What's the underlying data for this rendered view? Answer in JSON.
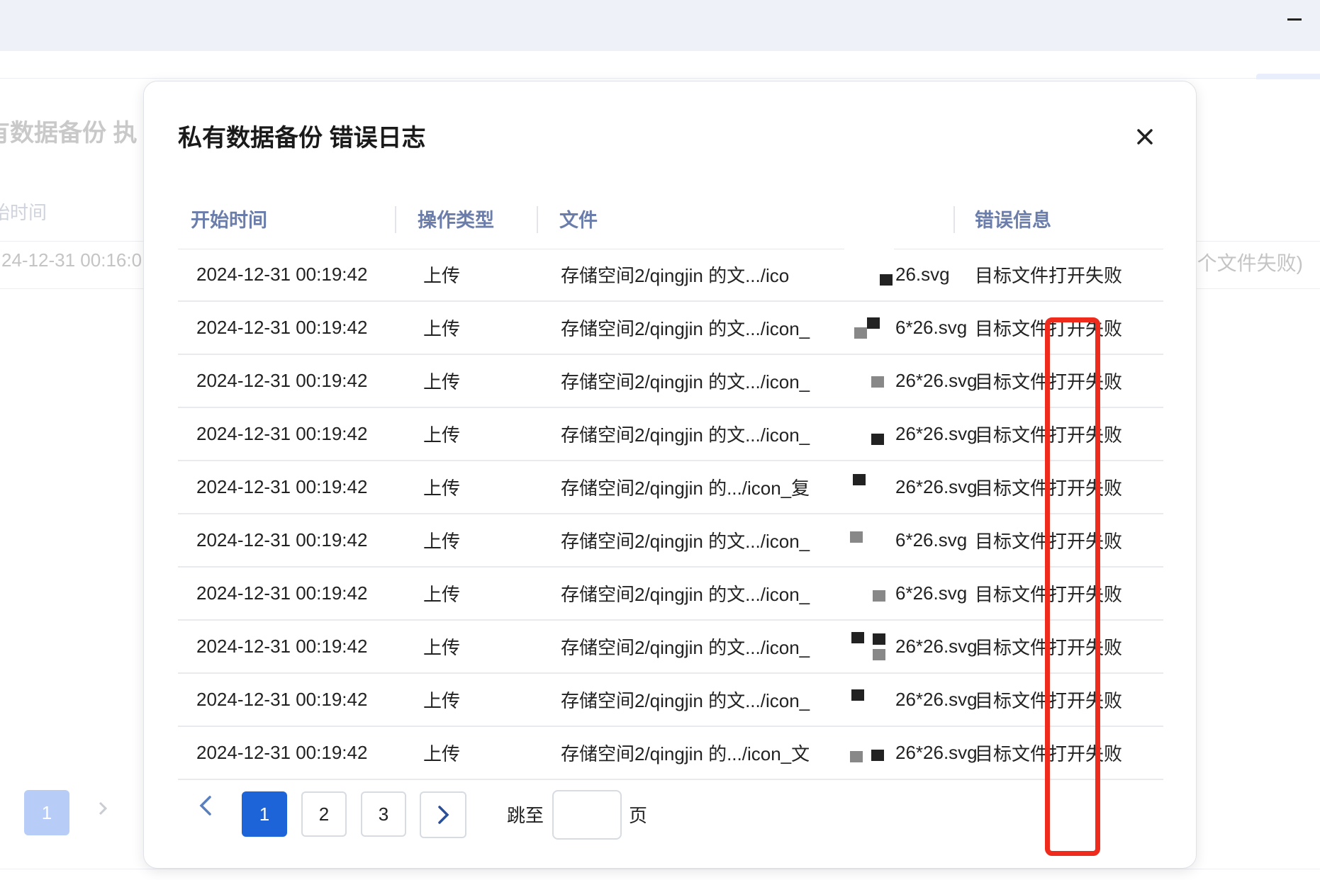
{
  "background": {
    "title": "有数据备份 执",
    "column_start_time": "始时间",
    "row_time": "24-12-31 00:16:0",
    "row_summary": "个文件失败)",
    "current_page": "1"
  },
  "modal": {
    "title": "私有数据备份 错误日志",
    "columns": [
      "开始时间",
      "操作类型",
      "文件",
      "错误信息"
    ],
    "rows": [
      {
        "time": "2024-12-31 00:19:42",
        "type": "上传",
        "file": "存储空间2/qingjin 的文.../ico",
        "suffix": "26.svg",
        "error": "目标文件打开失败"
      },
      {
        "time": "2024-12-31 00:19:42",
        "type": "上传",
        "file": "存储空间2/qingjin 的文.../icon_",
        "suffix": "6*26.svg",
        "error": "目标文件打开失败"
      },
      {
        "time": "2024-12-31 00:19:42",
        "type": "上传",
        "file": "存储空间2/qingjin 的文.../icon_",
        "suffix": "26*26.svg",
        "error": "目标文件打开失败"
      },
      {
        "time": "2024-12-31 00:19:42",
        "type": "上传",
        "file": "存储空间2/qingjin 的文.../icon_",
        "suffix": "26*26.svg",
        "error": "目标文件打开失败"
      },
      {
        "time": "2024-12-31 00:19:42",
        "type": "上传",
        "file": "存储空间2/qingjin 的.../icon_复",
        "suffix": "26*26.svg",
        "error": "目标文件打开失败"
      },
      {
        "time": "2024-12-31 00:19:42",
        "type": "上传",
        "file": "存储空间2/qingjin 的文.../icon_",
        "suffix": "6*26.svg",
        "error": "目标文件打开失败"
      },
      {
        "time": "2024-12-31 00:19:42",
        "type": "上传",
        "file": "存储空间2/qingjin 的文.../icon_",
        "suffix": "6*26.svg",
        "error": "目标文件打开失败"
      },
      {
        "time": "2024-12-31 00:19:42",
        "type": "上传",
        "file": "存储空间2/qingjin 的文.../icon_",
        "suffix": "26*26.svg",
        "error": "目标文件打开失败"
      },
      {
        "time": "2024-12-31 00:19:42",
        "type": "上传",
        "file": "存储空间2/qingjin 的文.../icon_",
        "suffix": "26*26.svg",
        "error": "目标文件打开失败"
      },
      {
        "time": "2024-12-31 00:19:42",
        "type": "上传",
        "file": "存储空间2/qingjin 的.../icon_文",
        "suffix": "26*26.svg",
        "error": "目标文件打开失败"
      }
    ],
    "pagination": {
      "pages": [
        "1",
        "2",
        "3"
      ],
      "active_page": "1",
      "jump_label": "跳至",
      "jump_value": "",
      "jump_suffix": "页"
    }
  },
  "colors": {
    "accent": "#1e64d9",
    "highlight": "#ee2b1d",
    "header_text": "#6b7dab"
  },
  "icons": [
    "minimize-icon",
    "close-icon",
    "chevron-left-icon",
    "chevron-right-icon"
  ]
}
